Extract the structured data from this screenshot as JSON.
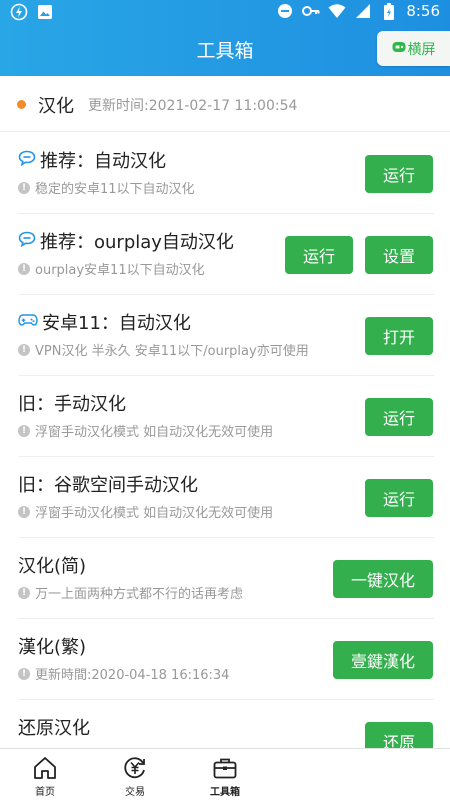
{
  "status_bar": {
    "time": "8:56"
  },
  "header": {
    "title": "工具箱",
    "landscape_label": "横屏"
  },
  "section": {
    "name": "汉化",
    "update_time": "更新时间:2021-02-17 11:00:54"
  },
  "items": [
    {
      "title": "推荐：自动汉化",
      "icon": "chat-icon",
      "subtitle": "稳定的安卓11以下自动汉化",
      "buttons": [
        "运行"
      ]
    },
    {
      "title": "推荐：ourplay自动汉化",
      "icon": "chat-icon",
      "subtitle": "ourplay安卓11以下自动汉化",
      "buttons": [
        "运行",
        "设置"
      ]
    },
    {
      "title": "安卓11：自动汉化",
      "icon": "gamepad-icon",
      "subtitle": "VPN汉化 半永久 安卓11以下/ourplay亦可使用",
      "buttons": [
        "打开"
      ]
    },
    {
      "title": "旧：手动汉化",
      "icon": "",
      "subtitle": "浮窗手动汉化模式 如自动汉化无效可使用",
      "buttons": [
        "运行"
      ]
    },
    {
      "title": "旧：谷歌空间手动汉化",
      "icon": "",
      "subtitle": "浮窗手动汉化模式 如自动汉化无效可使用",
      "buttons": [
        "运行"
      ]
    },
    {
      "title": "汉化(简)",
      "icon": "",
      "subtitle": "万一上面两种方式都不行的话再考虑",
      "buttons": [
        "一键汉化"
      ]
    },
    {
      "title": "漢化(繁)",
      "icon": "",
      "subtitle": "更新時間:2020-04-18 16:16:34",
      "buttons": [
        "壹鍵漢化"
      ]
    },
    {
      "title": "还原汉化",
      "icon": "",
      "subtitle": "",
      "buttons": [
        "还原"
      ]
    }
  ],
  "bottom_nav": [
    {
      "label": "首页",
      "icon": "home-icon"
    },
    {
      "label": "交易",
      "icon": "yuan-exchange-icon"
    },
    {
      "label": "工具箱",
      "icon": "toolbox-icon",
      "active": true
    }
  ],
  "colors": {
    "accent": "#33b04d",
    "header": "#1e8fe0",
    "dot": "#f28c28"
  }
}
